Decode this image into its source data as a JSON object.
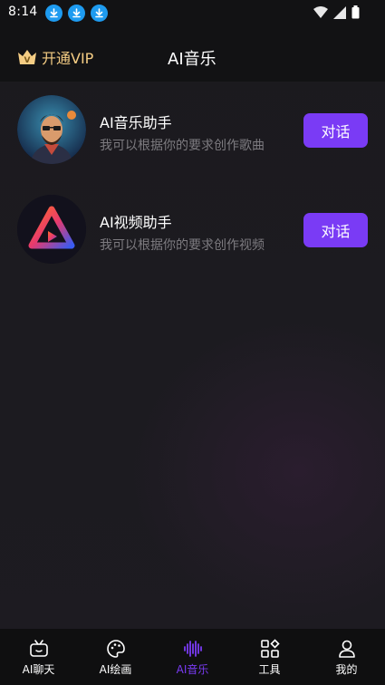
{
  "status": {
    "time": "8:14",
    "icons": [
      "download-icon",
      "download-icon",
      "download-icon"
    ],
    "right_icons": [
      "wifi-icon",
      "signal-icon",
      "battery-icon"
    ]
  },
  "header": {
    "vip_label": "开通VIP",
    "title": "AI音乐"
  },
  "assistants": [
    {
      "title": "AI音乐助手",
      "subtitle": "我可以根据你的要求创作歌曲",
      "button": "对话"
    },
    {
      "title": "AI视频助手",
      "subtitle": "我可以根据你的要求创作视频",
      "button": "对话"
    }
  ],
  "tabs": [
    {
      "label": "AI聊天",
      "icon": "tv-icon"
    },
    {
      "label": "AI绘画",
      "icon": "palette-icon"
    },
    {
      "label": "AI音乐",
      "icon": "waveform-icon",
      "active": true
    },
    {
      "label": "工具",
      "icon": "grid-icon"
    },
    {
      "label": "我的",
      "icon": "user-icon"
    }
  ],
  "colors": {
    "accent": "#7a3bf5",
    "vip": "#f5cd84",
    "download": "#1e9bf0"
  }
}
